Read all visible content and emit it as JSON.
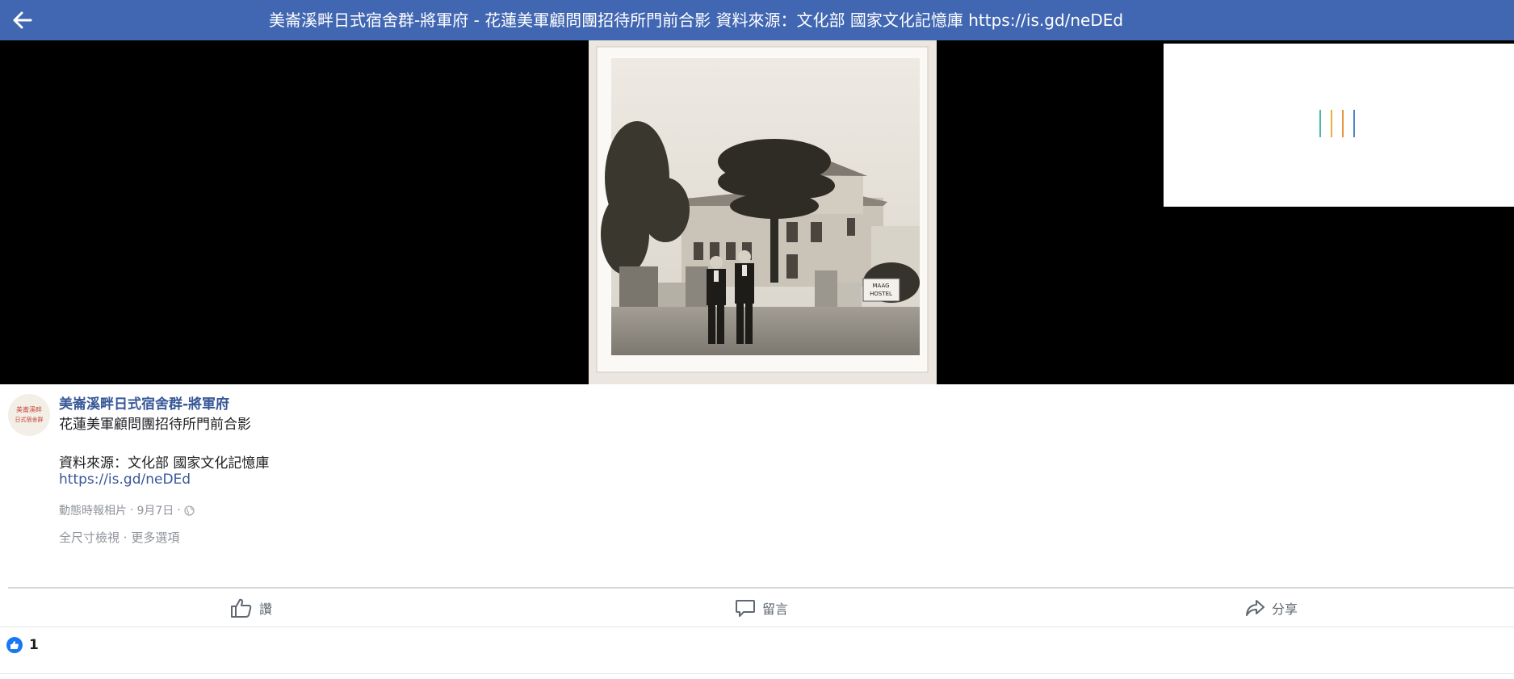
{
  "header": {
    "title": "美崙溪畔日式宿舍群-將軍府 - 花蓮美軍顧問團招待所門前合影 資料來源：文化部 國家文化記憶庫 https://is.gd/neDEd"
  },
  "photo": {
    "sign_text": [
      "MAAG",
      "HOSTEL"
    ]
  },
  "loader": {
    "bar_colors": [
      "#4cb8a8",
      "#e6b23c",
      "#e8913a",
      "#4a86c8"
    ]
  },
  "post": {
    "page_name": "美崙溪畔日式宿舍群-將軍府",
    "avatar_text": [
      "美崙溪畔",
      "日式宿舍群"
    ],
    "caption_line1": "花蓮美軍顧問團招待所門前合影",
    "caption_line2": "資料來源：文化部 國家文化記憶庫",
    "caption_link": "https://is.gd/neDEd",
    "meta_type": "動態時報相片",
    "meta_sep": "·",
    "meta_date": "9月7日",
    "privacy_icon": "globe-icon",
    "action_fullsize": "全尺寸檢視",
    "action_more": "更多選項"
  },
  "actions": {
    "like": "讚",
    "comment": "留言",
    "share": "分享"
  },
  "reactions": {
    "count": "1"
  },
  "colors": {
    "header_bg": "#4267b2",
    "link": "#385898",
    "like_blue": "#1877f2"
  }
}
